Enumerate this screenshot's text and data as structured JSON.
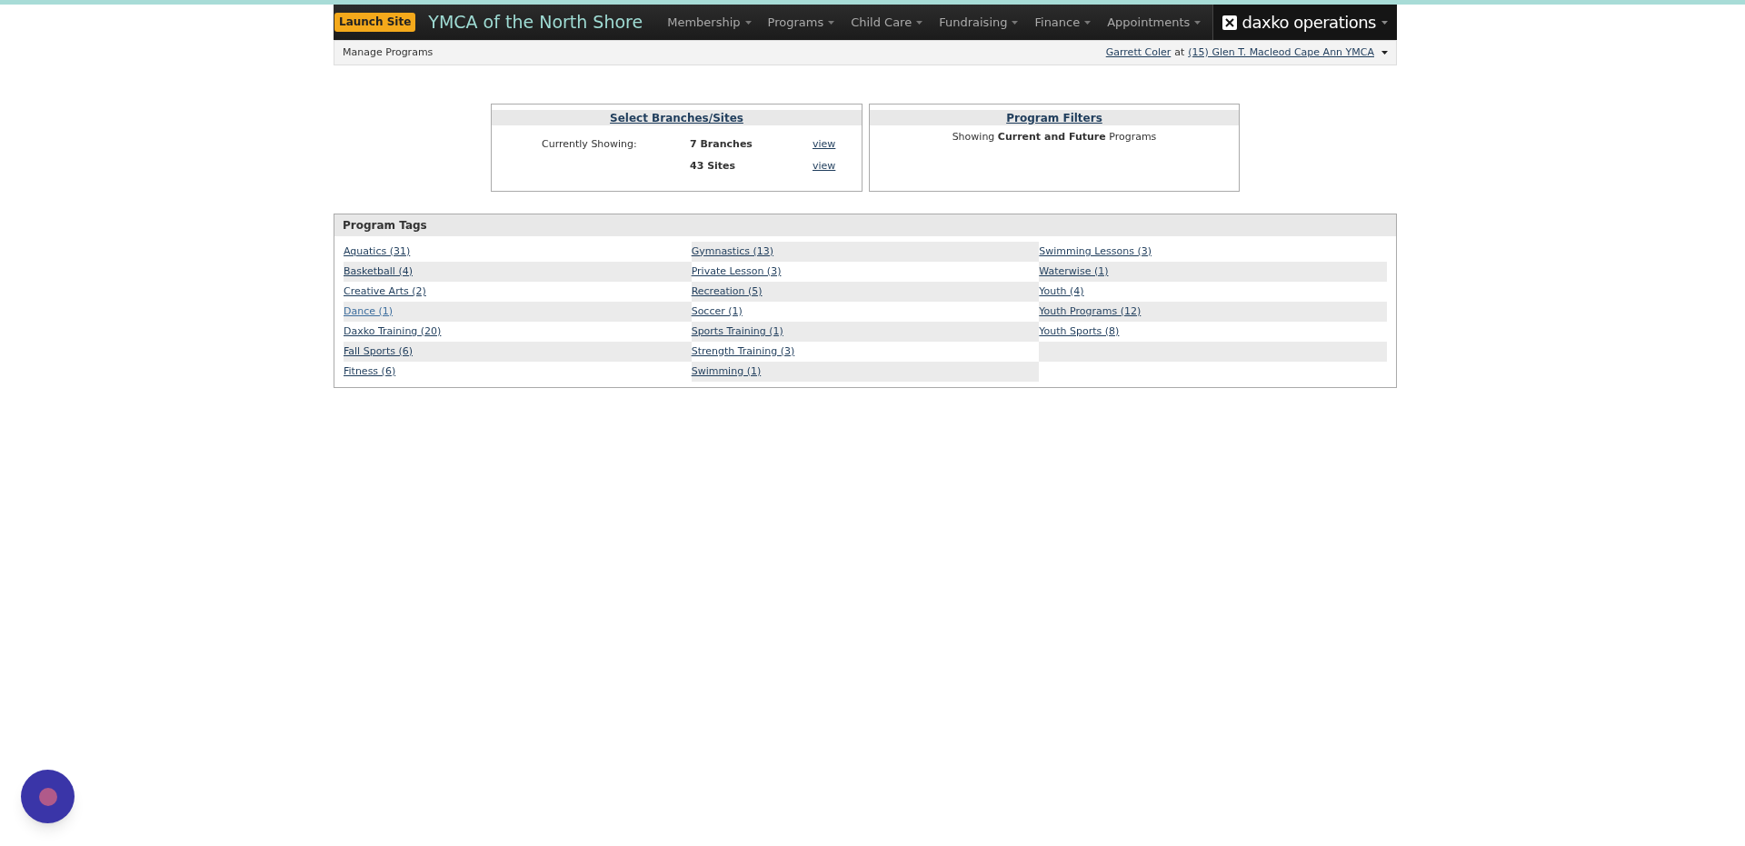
{
  "header": {
    "launch_button": "Launch Site",
    "site_title": "YMCA of the North Shore",
    "nav": [
      {
        "label": "Membership"
      },
      {
        "label": "Programs"
      },
      {
        "label": "Child Care"
      },
      {
        "label": "Fundraising"
      },
      {
        "label": "Finance"
      },
      {
        "label": "Appointments"
      }
    ],
    "brand": "daxko operations"
  },
  "subheader": {
    "page_title": "Manage Programs",
    "user": "Garrett Coler",
    "joiner": "at",
    "location": "(15) Glen T. Macleod Cape Ann YMCA"
  },
  "branches_panel": {
    "title": "Select Branches/Sites",
    "label": "Currently Showing:",
    "rows": [
      {
        "value": "7 Branches",
        "link": "view"
      },
      {
        "value": "43 Sites",
        "link": "view"
      }
    ]
  },
  "filters_panel": {
    "title": "Program Filters",
    "text": "Showing **Current and Future** Programs"
  },
  "tags_panel": {
    "title": "Program Tags",
    "tags": [
      {
        "label": "Aquatics (31)",
        "visited": false
      },
      {
        "label": "Basketball (4)",
        "visited": false
      },
      {
        "label": "Creative Arts (2)",
        "visited": false
      },
      {
        "label": "Dance (1)",
        "visited": true
      },
      {
        "label": "Daxko Training (20)",
        "visited": false
      },
      {
        "label": "Fall Sports (6)",
        "visited": false
      },
      {
        "label": "Fitness (6)",
        "visited": false
      },
      {
        "label": "Gymnastics (13)",
        "visited": false
      },
      {
        "label": "Private Lesson (3)",
        "visited": false
      },
      {
        "label": "Recreation (5)",
        "visited": false
      },
      {
        "label": "Soccer (1)",
        "visited": false
      },
      {
        "label": "Sports Training (1)",
        "visited": false
      },
      {
        "label": "Strength Training (3)",
        "visited": false
      },
      {
        "label": "Swimming (1)",
        "visited": false
      },
      {
        "label": "Swimming Lessons (3)",
        "visited": false
      },
      {
        "label": "Waterwise (1)",
        "visited": false
      },
      {
        "label": "Youth (4)",
        "visited": false
      },
      {
        "label": "Youth Programs (12)",
        "visited": false
      },
      {
        "label": "Youth Sports (8)",
        "visited": false
      }
    ]
  }
}
